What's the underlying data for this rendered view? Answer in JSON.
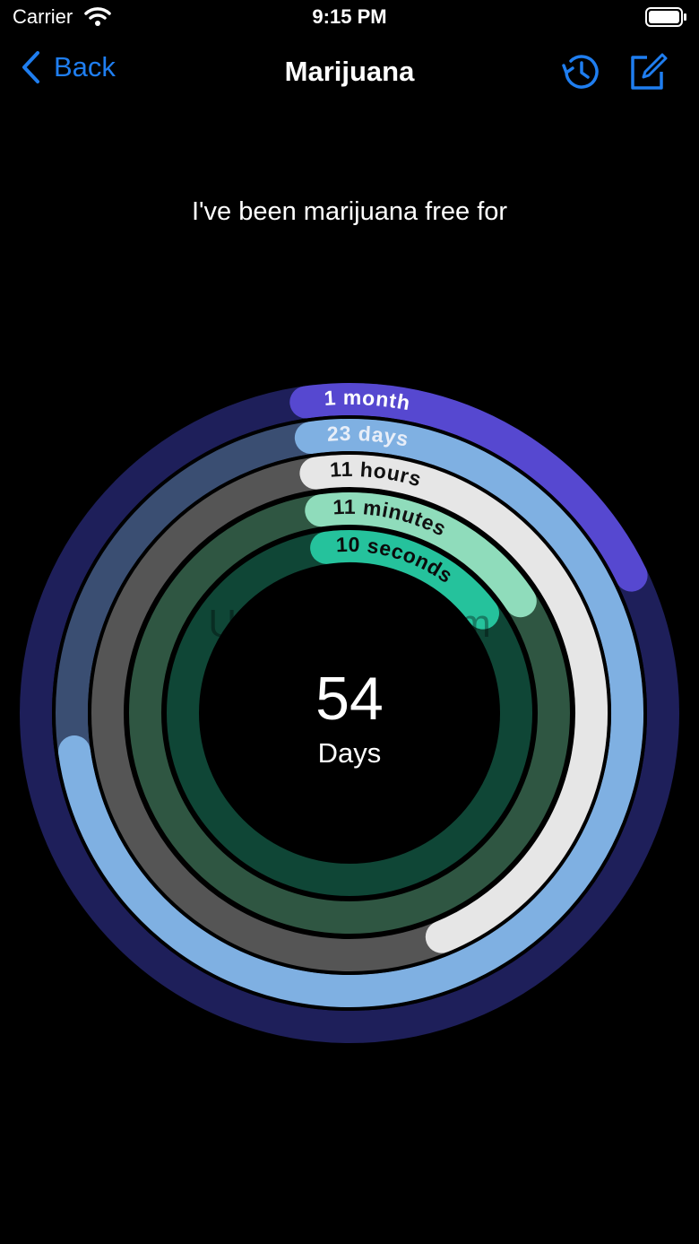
{
  "status": {
    "carrier": "Carrier",
    "time": "9:15 PM"
  },
  "nav": {
    "back_label": "Back",
    "title": "Marijuana"
  },
  "headline": "I've been marijuana free for",
  "counter": {
    "value": "54",
    "unit": "Days"
  },
  "watermark": "UpdateStar.com",
  "rings": [
    {
      "label": "1 month",
      "color": "#5648d0",
      "track": "#1e1f5a",
      "text_color": "#ffffff",
      "progress": 0.2
    },
    {
      "label": "23 days",
      "color": "#7fb0e2",
      "track": "#3a4e72",
      "text_color": "#e8eef8",
      "progress": 0.75
    },
    {
      "label": "11 hours",
      "color": "#e6e6e6",
      "track": "#555555",
      "text_color": "#111111",
      "progress": 0.46
    },
    {
      "label": "11 minutes",
      "color": "#8fdcbb",
      "track": "#2f5642",
      "text_color": "#111111",
      "progress": 0.18
    },
    {
      "label": "10 seconds",
      "color": "#25c29c",
      "track": "#0f4636",
      "text_color": "#0b0b0b",
      "progress": 0.17
    }
  ]
}
